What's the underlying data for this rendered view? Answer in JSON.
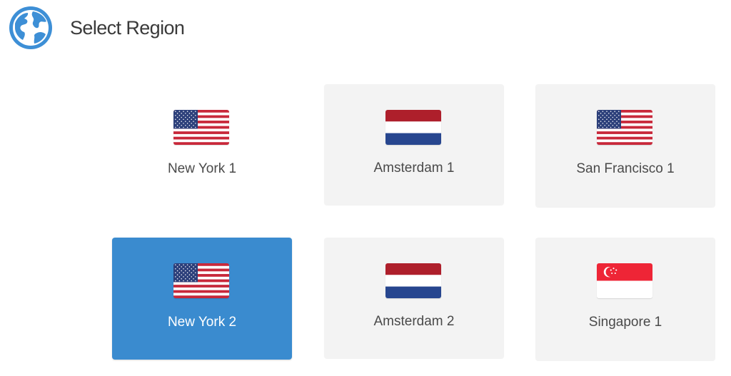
{
  "header": {
    "title": "Select Region",
    "icon": "globe-icon"
  },
  "colors": {
    "card_background": "#f3f3f3",
    "selected_background": "#3a8bcf",
    "globe_blue": "#3d8fd6"
  },
  "regions": [
    {
      "label": "New York 1",
      "flag": "us-flag-icon",
      "selected": false
    },
    {
      "label": "Amsterdam 1",
      "flag": "netherlands-flag-icon",
      "selected": false
    },
    {
      "label": "San Francisco 1",
      "flag": "us-flag-icon",
      "selected": false
    },
    {
      "label": "New York 2",
      "flag": "us-flag-icon",
      "selected": true
    },
    {
      "label": "Amsterdam 2",
      "flag": "netherlands-flag-icon",
      "selected": false
    },
    {
      "label": "Singapore 1",
      "flag": "singapore-flag-icon",
      "selected": false
    }
  ]
}
